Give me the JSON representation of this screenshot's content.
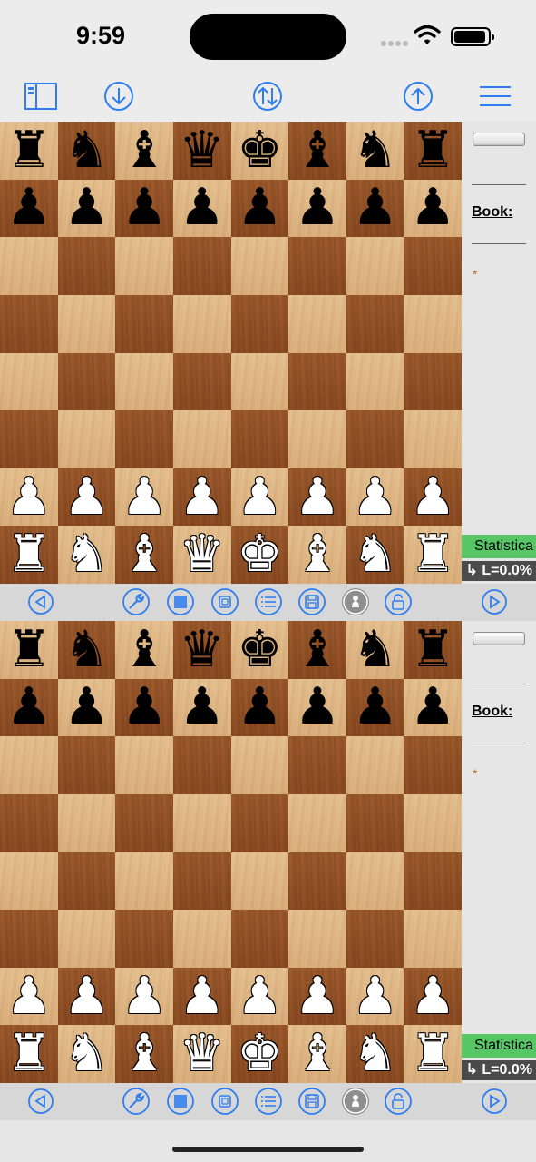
{
  "status": {
    "time": "9:59"
  },
  "toolbar": {
    "items": [
      "sidebar-icon",
      "download-icon",
      "flip-board-icon",
      "upload-icon",
      "menu-icon"
    ]
  },
  "games": [
    {
      "board": [
        [
          "br",
          "bn",
          "bb",
          "bq",
          "bk",
          "bb",
          "bn",
          "br"
        ],
        [
          "bp",
          "bp",
          "bp",
          "bp",
          "bp",
          "bp",
          "bp",
          "bp"
        ],
        [
          "",
          "",
          "",
          "",
          "",
          "",
          "",
          ""
        ],
        [
          "",
          "",
          "",
          "",
          "",
          "",
          "",
          ""
        ],
        [
          "",
          "",
          "",
          "",
          "",
          "",
          "",
          ""
        ],
        [
          "",
          "",
          "",
          "",
          "",
          "",
          "",
          ""
        ],
        [
          "wp",
          "wp",
          "wp",
          "wp",
          "wp",
          "wp",
          "wp",
          "wp"
        ],
        [
          "wr",
          "wn",
          "wb",
          "wq",
          "wk",
          "wb",
          "wn",
          "wr"
        ]
      ],
      "side": {
        "book_label": "Book:",
        "result": "*"
      },
      "statistics_label": "Statistica",
      "eval_label": "L=0.0%"
    },
    {
      "board": [
        [
          "br",
          "bn",
          "bb",
          "bq",
          "bk",
          "bb",
          "bn",
          "br"
        ],
        [
          "bp",
          "bp",
          "bp",
          "bp",
          "bp",
          "bp",
          "bp",
          "bp"
        ],
        [
          "",
          "",
          "",
          "",
          "",
          "",
          "",
          ""
        ],
        [
          "",
          "",
          "",
          "",
          "",
          "",
          "",
          ""
        ],
        [
          "",
          "",
          "",
          "",
          "",
          "",
          "",
          ""
        ],
        [
          "",
          "",
          "",
          "",
          "",
          "",
          "",
          ""
        ],
        [
          "wp",
          "wp",
          "wp",
          "wp",
          "wp",
          "wp",
          "wp",
          "wp"
        ],
        [
          "wr",
          "wn",
          "wb",
          "wq",
          "wk",
          "wb",
          "wn",
          "wr"
        ]
      ],
      "side": {
        "book_label": "Book:",
        "result": "*"
      },
      "statistics_label": "Statistica",
      "eval_label": "L=0.0%"
    }
  ],
  "controls": [
    "previous-move-icon",
    "wrench-icon",
    "board-texture-icon",
    "engine-chip-icon",
    "move-list-icon",
    "save-icon",
    "pawn-icon",
    "lock-icon",
    "next-move-icon"
  ],
  "colors": {
    "accent": "#2f7ef0",
    "stat_green": "#57c765",
    "eval_gray": "#4b4b4b",
    "light_square": "#e0b887",
    "dark_square": "#93522a"
  }
}
